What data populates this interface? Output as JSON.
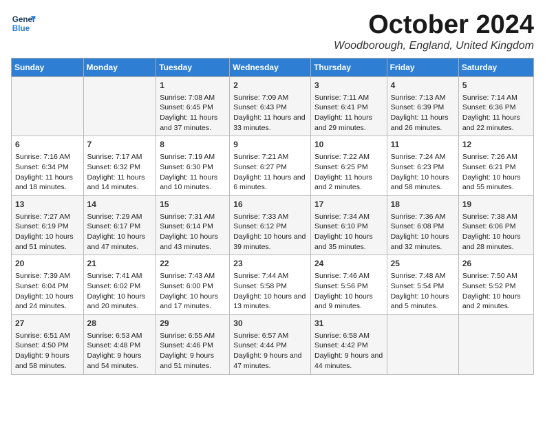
{
  "logo": {
    "line1": "General",
    "line2": "Blue"
  },
  "title": "October 2024",
  "subtitle": "Woodborough, England, United Kingdom",
  "days_of_week": [
    "Sunday",
    "Monday",
    "Tuesday",
    "Wednesday",
    "Thursday",
    "Friday",
    "Saturday"
  ],
  "weeks": [
    [
      {
        "day": "",
        "info": ""
      },
      {
        "day": "",
        "info": ""
      },
      {
        "day": "1",
        "info": "Sunrise: 7:08 AM\nSunset: 6:45 PM\nDaylight: 11 hours and 37 minutes."
      },
      {
        "day": "2",
        "info": "Sunrise: 7:09 AM\nSunset: 6:43 PM\nDaylight: 11 hours and 33 minutes."
      },
      {
        "day": "3",
        "info": "Sunrise: 7:11 AM\nSunset: 6:41 PM\nDaylight: 11 hours and 29 minutes."
      },
      {
        "day": "4",
        "info": "Sunrise: 7:13 AM\nSunset: 6:39 PM\nDaylight: 11 hours and 26 minutes."
      },
      {
        "day": "5",
        "info": "Sunrise: 7:14 AM\nSunset: 6:36 PM\nDaylight: 11 hours and 22 minutes."
      }
    ],
    [
      {
        "day": "6",
        "info": "Sunrise: 7:16 AM\nSunset: 6:34 PM\nDaylight: 11 hours and 18 minutes."
      },
      {
        "day": "7",
        "info": "Sunrise: 7:17 AM\nSunset: 6:32 PM\nDaylight: 11 hours and 14 minutes."
      },
      {
        "day": "8",
        "info": "Sunrise: 7:19 AM\nSunset: 6:30 PM\nDaylight: 11 hours and 10 minutes."
      },
      {
        "day": "9",
        "info": "Sunrise: 7:21 AM\nSunset: 6:27 PM\nDaylight: 11 hours and 6 minutes."
      },
      {
        "day": "10",
        "info": "Sunrise: 7:22 AM\nSunset: 6:25 PM\nDaylight: 11 hours and 2 minutes."
      },
      {
        "day": "11",
        "info": "Sunrise: 7:24 AM\nSunset: 6:23 PM\nDaylight: 10 hours and 58 minutes."
      },
      {
        "day": "12",
        "info": "Sunrise: 7:26 AM\nSunset: 6:21 PM\nDaylight: 10 hours and 55 minutes."
      }
    ],
    [
      {
        "day": "13",
        "info": "Sunrise: 7:27 AM\nSunset: 6:19 PM\nDaylight: 10 hours and 51 minutes."
      },
      {
        "day": "14",
        "info": "Sunrise: 7:29 AM\nSunset: 6:17 PM\nDaylight: 10 hours and 47 minutes."
      },
      {
        "day": "15",
        "info": "Sunrise: 7:31 AM\nSunset: 6:14 PM\nDaylight: 10 hours and 43 minutes."
      },
      {
        "day": "16",
        "info": "Sunrise: 7:33 AM\nSunset: 6:12 PM\nDaylight: 10 hours and 39 minutes."
      },
      {
        "day": "17",
        "info": "Sunrise: 7:34 AM\nSunset: 6:10 PM\nDaylight: 10 hours and 35 minutes."
      },
      {
        "day": "18",
        "info": "Sunrise: 7:36 AM\nSunset: 6:08 PM\nDaylight: 10 hours and 32 minutes."
      },
      {
        "day": "19",
        "info": "Sunrise: 7:38 AM\nSunset: 6:06 PM\nDaylight: 10 hours and 28 minutes."
      }
    ],
    [
      {
        "day": "20",
        "info": "Sunrise: 7:39 AM\nSunset: 6:04 PM\nDaylight: 10 hours and 24 minutes."
      },
      {
        "day": "21",
        "info": "Sunrise: 7:41 AM\nSunset: 6:02 PM\nDaylight: 10 hours and 20 minutes."
      },
      {
        "day": "22",
        "info": "Sunrise: 7:43 AM\nSunset: 6:00 PM\nDaylight: 10 hours and 17 minutes."
      },
      {
        "day": "23",
        "info": "Sunrise: 7:44 AM\nSunset: 5:58 PM\nDaylight: 10 hours and 13 minutes."
      },
      {
        "day": "24",
        "info": "Sunrise: 7:46 AM\nSunset: 5:56 PM\nDaylight: 10 hours and 9 minutes."
      },
      {
        "day": "25",
        "info": "Sunrise: 7:48 AM\nSunset: 5:54 PM\nDaylight: 10 hours and 5 minutes."
      },
      {
        "day": "26",
        "info": "Sunrise: 7:50 AM\nSunset: 5:52 PM\nDaylight: 10 hours and 2 minutes."
      }
    ],
    [
      {
        "day": "27",
        "info": "Sunrise: 6:51 AM\nSunset: 4:50 PM\nDaylight: 9 hours and 58 minutes."
      },
      {
        "day": "28",
        "info": "Sunrise: 6:53 AM\nSunset: 4:48 PM\nDaylight: 9 hours and 54 minutes."
      },
      {
        "day": "29",
        "info": "Sunrise: 6:55 AM\nSunset: 4:46 PM\nDaylight: 9 hours and 51 minutes."
      },
      {
        "day": "30",
        "info": "Sunrise: 6:57 AM\nSunset: 4:44 PM\nDaylight: 9 hours and 47 minutes."
      },
      {
        "day": "31",
        "info": "Sunrise: 6:58 AM\nSunset: 4:42 PM\nDaylight: 9 hours and 44 minutes."
      },
      {
        "day": "",
        "info": ""
      },
      {
        "day": "",
        "info": ""
      }
    ]
  ]
}
